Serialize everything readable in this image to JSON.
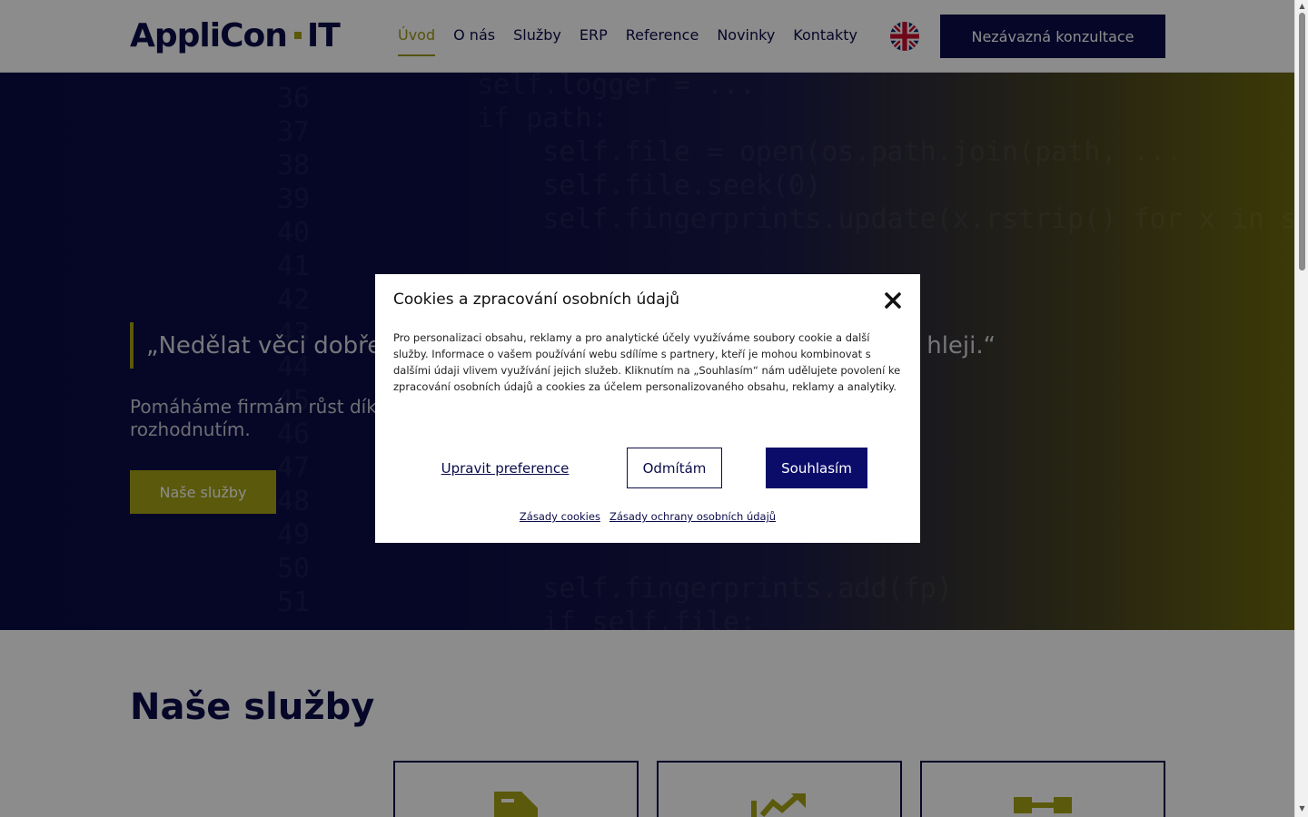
{
  "header": {
    "logo_text_left": "AppliCon",
    "logo_text_right": "IT",
    "nav": [
      {
        "label": "Úvod",
        "active": true
      },
      {
        "label": "O nás"
      },
      {
        "label": "Služby"
      },
      {
        "label": "ERP"
      },
      {
        "label": "Reference"
      },
      {
        "label": "Novinky"
      },
      {
        "label": "Kontakty"
      }
    ],
    "language_icon": "uk-flag-icon",
    "cta_label": "Nezávazná konzultace"
  },
  "hero": {
    "quote": "„Nedělat věci dobře, ale dělat je … rychleji.“",
    "quote_visible_left": "„Nedělat věci dobře",
    "quote_visible_right": "hleji.“",
    "subtitle_line1": "Pomáháme firmám růst díky",
    "subtitle_line2": "rozhodnutím.",
    "button_label": "Naše služby",
    "code_lines": "36\n37\n38\n39\n40\n41\n42\n43\n44\n45\n46\n47\n48\n49\n50\n51",
    "code_src": "self.logger = ...\nif path:\n    self.file = open(os.path.join(path, ...\n    self.file.seek(0)\n    self.fingerprints.update(x.rstrip() for x in self.file)\n\n\n\n\n\n\n\n\n\n\n    self.fingerprints.add(fp)\n    if self.file:\n        self.file.write(fp + os.linesep)"
  },
  "services": {
    "title": "Naše služby",
    "cards": [
      {
        "icon": "document-icon"
      },
      {
        "icon": "chart-trend-icon"
      },
      {
        "icon": "hierarchy-icon"
      }
    ]
  },
  "cookie_modal": {
    "title": "Cookies a zpracování osobních údajů",
    "close_icon": "close-icon",
    "text": "Pro personalizaci obsahu, reklamy a pro analytické účely využíváme soubory cookie a další služby. Informace o vašem používání webu sdílíme s partnery, kteří je mohou kombinovat s dalšími údaji vlivem využívání jejich služeb. Kliknutím na „Souhlasím“ nám udělujete povolení ke zpracování osobních údajů a cookies za účelem personalizovaného obsahu, reklamy a analytiky.",
    "preferences_label": "Upravit preference",
    "deny_label": "Odmítám",
    "accept_label": "Souhlasím",
    "links": [
      "Zásady cookies",
      "Zásady ochrany osobních údajů"
    ]
  },
  "colors": {
    "navy": "#0b0c4a",
    "accent": "#a7a315"
  }
}
